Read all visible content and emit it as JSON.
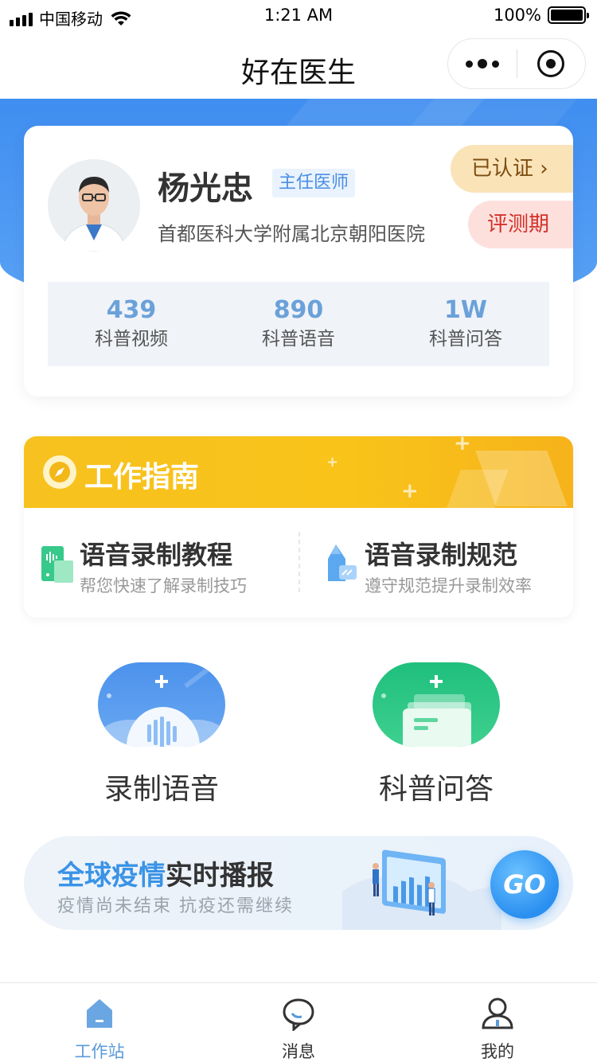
{
  "status_bar": {
    "carrier": "中国移动",
    "time": "1:21 AM",
    "battery": "100%"
  },
  "nav": {
    "title": "好在医生"
  },
  "profile": {
    "name": "杨光忠",
    "title_badge": "主任医师",
    "hospital": "首都医科大学附属北京朝阳医院",
    "certified_label": "已认证 ›",
    "eval_label": "评测期",
    "stats": [
      {
        "value": "439",
        "label": "科普视频"
      },
      {
        "value": "890",
        "label": "科普语音"
      },
      {
        "value": "1W",
        "label": "科普问答"
      }
    ]
  },
  "guide": {
    "title": "工作指南",
    "items": [
      {
        "title": "语音录制教程",
        "subtitle": "帮您快速了解录制技巧"
      },
      {
        "title": "语音录制规范",
        "subtitle": "遵守规范提升录制效率"
      }
    ]
  },
  "actions": [
    {
      "label": "录制语音"
    },
    {
      "label": "科普问答"
    }
  ],
  "banner": {
    "title_highlight": "全球疫情",
    "title_rest": "实时播报",
    "subtitle": "疫情尚未结束 抗疫还需继续",
    "go_label": "GO"
  },
  "tabs": [
    {
      "label": "工作站",
      "active": true
    },
    {
      "label": "消息",
      "active": false
    },
    {
      "label": "我的",
      "active": false
    }
  ],
  "colors": {
    "primary_blue": "#4a8ee3",
    "guide_yellow": "#f7c21f",
    "green": "#1fbf7d",
    "tab_active": "#5a9ad9"
  }
}
